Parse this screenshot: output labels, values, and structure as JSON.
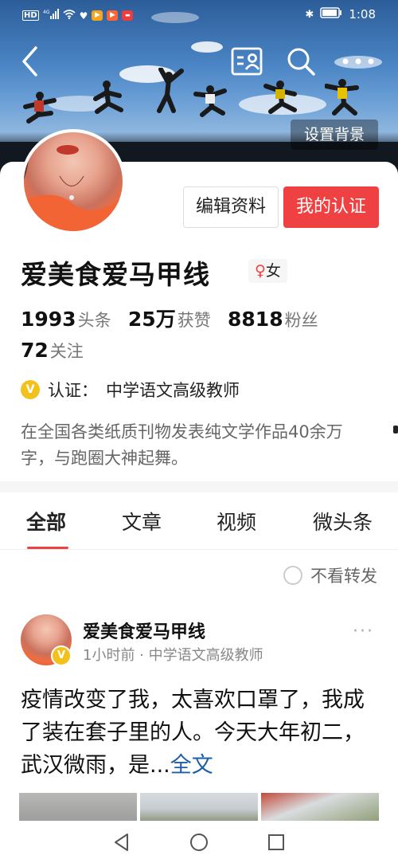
{
  "status_bar": {
    "left_icons": [
      "hd-icon",
      "signal-4g-icon",
      "wifi-icon",
      "heart-app-icon",
      "app-notification-icon",
      "video-app-icon",
      "app-notification-icon-2"
    ],
    "network_label": "HD",
    "time": "1:08"
  },
  "header": {
    "back_icon": "back-arrow-icon",
    "card_icon": "profile-card-icon",
    "search_icon": "search-icon",
    "more_icon": "more-icon",
    "set_background_label": "设置背景"
  },
  "profile": {
    "edit_button_label": "编辑资料",
    "certify_button_label": "我的认证",
    "name": "爱美食爱马甲线",
    "gender_symbol": "♀",
    "gender_label": "女",
    "stats": {
      "toutiao_count": "1993",
      "toutiao_label": "头条",
      "likes_count": "25万",
      "likes_label": "获赞",
      "fans_count": "8818",
      "fans_label": "粉丝",
      "following_count": "72",
      "following_label": "关注"
    },
    "certification_badge": "V",
    "certification_label": "认证：",
    "certification_value": "中学语文高级教师",
    "bio": "在全国各类纸质刊物发表纯文学作品40余万字，与跑圈大神起舞。"
  },
  "tabs": [
    {
      "label": "全部",
      "active": true
    },
    {
      "label": "文章",
      "active": false
    },
    {
      "label": "视频",
      "active": false
    },
    {
      "label": "微头条",
      "active": false
    }
  ],
  "filter": {
    "no_repost_label": "不看转发"
  },
  "post": {
    "author_name": "爱美食爱马甲线",
    "badge": "V",
    "meta": "1小时前 · 中学语文高级教师",
    "more_label": "···",
    "text": "疫情改变了我，太喜欢口罩了，我成了装在套子里的人。今天大年初二，武汉微雨，是...",
    "full_text_link": "全文"
  },
  "nav_bar": {
    "back_icon": "nav-back-icon",
    "home_icon": "nav-home-icon",
    "recents_icon": "nav-recents-icon"
  },
  "colors": {
    "accent_red": "#f04142",
    "verified_gold": "#f3c11b",
    "link_blue": "#1e5fa8"
  }
}
